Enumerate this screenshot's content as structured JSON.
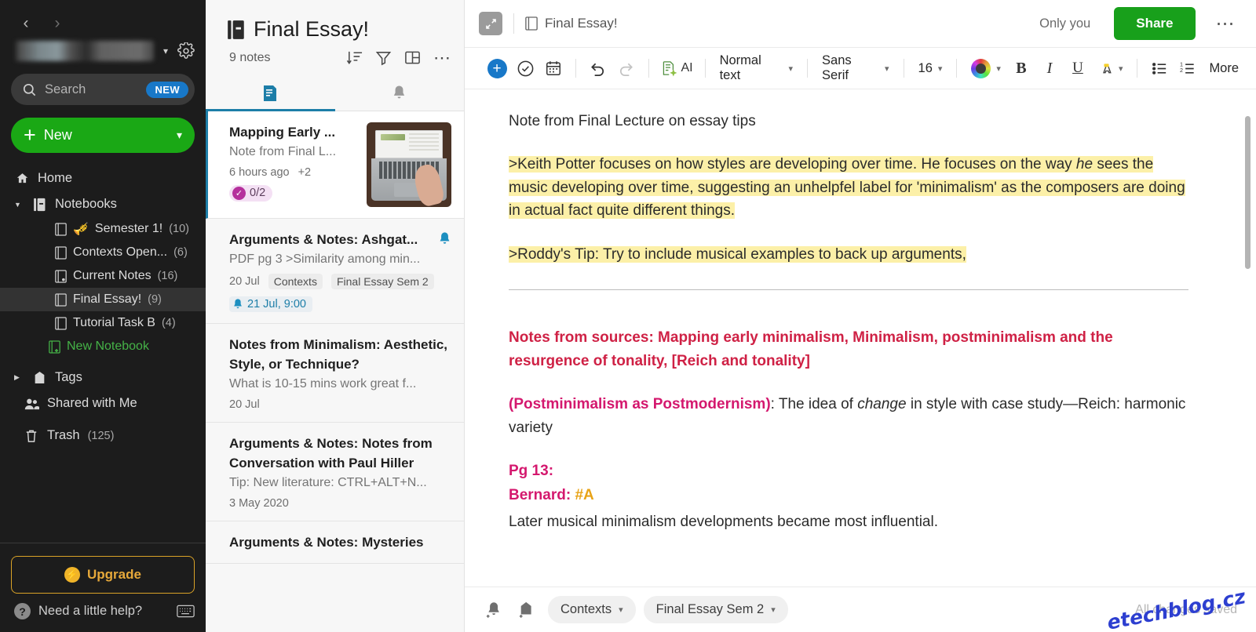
{
  "sidebar": {
    "nav_back_icon": "chevron-left-icon",
    "nav_forward_icon": "chevron-right-icon",
    "account_caret_icon": "chevron-down-icon",
    "settings_icon": "gear-icon",
    "search": {
      "placeholder": "Search",
      "badge": "NEW",
      "icon": "search-icon"
    },
    "new_button": {
      "label": "New",
      "plus": "+",
      "caret": "⌄"
    },
    "home": {
      "label": "Home",
      "icon": "home-icon"
    },
    "notebooks": {
      "label": "Notebooks",
      "icon": "notebooks-icon"
    },
    "notebook_items": [
      {
        "label": "Semester 1!",
        "count": "(10)",
        "emoji": "🎺"
      },
      {
        "label": "Contexts Open...",
        "count": "(6)",
        "emoji": ""
      },
      {
        "label": "Current Notes",
        "count": "(16)",
        "emoji": ""
      },
      {
        "label": "Final Essay!",
        "count": "(9)",
        "emoji": ""
      },
      {
        "label": "Tutorial Task B",
        "count": "(4)",
        "emoji": ""
      }
    ],
    "new_notebook": {
      "label": "New Notebook",
      "icon": "new-notebook-icon"
    },
    "tags": {
      "label": "Tags",
      "icon": "tag-icon"
    },
    "shared": {
      "label": "Shared with Me",
      "icon": "people-icon"
    },
    "trash": {
      "label": "Trash",
      "count": "(125)",
      "icon": "trash-icon"
    },
    "upgrade": {
      "label": "Upgrade",
      "icon": "bolt-icon"
    },
    "help": {
      "label": "Need a little help?",
      "icon": "question-icon",
      "keyboard_icon": "keyboard-icon"
    },
    "accent_green": "#1aa815",
    "accent_amber": "#e7a93a"
  },
  "notelist": {
    "title": "Final Essay!",
    "title_icon": "notebook-icon",
    "count_label": "9 notes",
    "sort_icon": "sort-icon",
    "filter_icon": "filter-icon",
    "view_icon": "layout-icon",
    "more_icon": "more-horizontal-icon",
    "tabs": [
      {
        "name": "notes-tab",
        "icon": "note-icon",
        "active": true
      },
      {
        "name": "reminders-tab",
        "icon": "bell-icon",
        "active": false
      }
    ],
    "notes": [
      {
        "title": "Mapping Early ...",
        "snippet": "Note from Final L...",
        "date": "6 hours ago",
        "extra": "+2",
        "task_badge": "0/2",
        "has_thumbnail": true
      },
      {
        "title": "Arguments & Notes: Ashgat...",
        "snippet": "PDF pg 3 >Similarity among min...",
        "date": "20 Jul",
        "tags": [
          "Contexts",
          "Final Essay Sem 2"
        ],
        "reminder": "21 Jul, 9:00",
        "has_bell": true
      },
      {
        "title": "Notes from Minimalism: Aesthetic, Style, or Technique?",
        "snippet": "What is 10-15 mins work great f...",
        "date": "20 Jul"
      },
      {
        "title": "Arguments & Notes: Notes from Conversation with Paul Hiller",
        "snippet": "Tip: New literature: CTRL+ALT+N...",
        "date": "3 May 2020"
      },
      {
        "title": "Arguments & Notes: Mysteries",
        "snippet": "",
        "date": ""
      }
    ]
  },
  "editor": {
    "expand_icon": "expand-icon",
    "breadcrumb_icon": "notebook-icon",
    "breadcrumb": "Final Essay!",
    "privacy_label": "Only you",
    "share_label": "Share",
    "more_icon": "more-horizontal-icon",
    "toolbar": {
      "insert_icon": "plus-circle-icon",
      "task_icon": "check-circle-icon",
      "calendar_icon": "calendar-icon",
      "undo_icon": "undo-icon",
      "redo_icon": "redo-icon",
      "ai_label": "AI",
      "ai_icon": "ai-sparkle-icon",
      "paragraph_style": "Normal text",
      "font_family": "Sans Serif",
      "font_size": "16",
      "color_icon": "color-wheel-icon",
      "bold_label": "B",
      "italic_label": "I",
      "underline_label": "U",
      "highlight_icon": "highlighter-icon",
      "bullet_list_icon": "bulleted-list-icon",
      "numbered_list_icon": "numbered-list-icon",
      "more_label": "More"
    },
    "content": {
      "intro": "Note from Final Lecture on essay tips",
      "quote1_a": ">Keith Potter focuses on how styles are developing over time. He focuses on the way ",
      "quote1_em": "he",
      "quote1_b": " sees the music developing over time, suggesting an unhelpfel label for 'minimalism' as the composers are doing in actual fact quite different things.",
      "quote2": ">Roddy's Tip: Try to include musical examples to back up arguments,",
      "heading_sources": "Notes from sources: Mapping early minimalism, Minimalism, postminimalism and the resurgence of tonality, [Reich and tonality]",
      "postmin_head": "(Postminimalism as Postmodernism)",
      "postmin_a": ": The idea of ",
      "postmin_em": "change",
      "postmin_b": " in style with case study—Reich: harmonic variety",
      "pg_label": "Pg 13:",
      "bernard_label": "Bernard:",
      "bernard_tag": "#A",
      "bernard_text": "Later musical minimalism developments became most influential."
    },
    "bottom": {
      "add_reminder_icon": "bell-plus-icon",
      "add_tag_icon": "tag-plus-icon",
      "tags": [
        "Contexts",
        "Final Essay Sem 2"
      ],
      "save_status": "All changes saved",
      "watermark": "etechblog.cz"
    }
  }
}
